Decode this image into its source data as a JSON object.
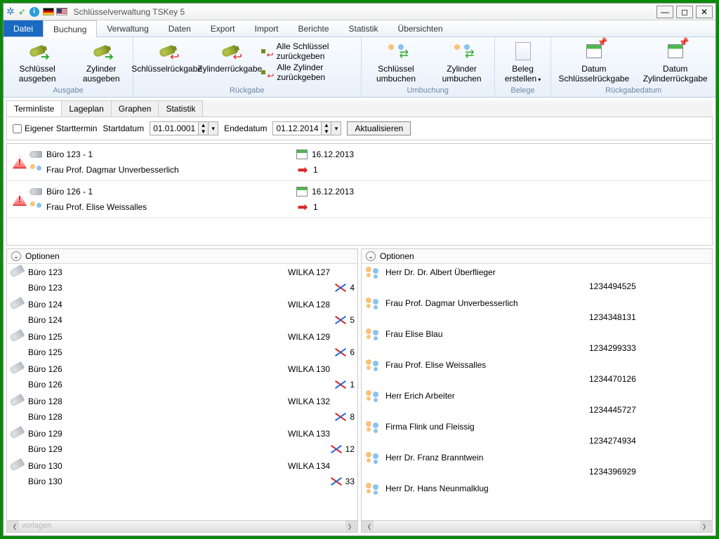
{
  "title": "Schlüsselverwaltung TSKey 5",
  "menu": {
    "datei": "Datei",
    "buchung": "Buchung",
    "verwaltung": "Verwaltung",
    "daten": "Daten",
    "export": "Export",
    "import": "Import",
    "berichte": "Berichte",
    "statistik": "Statistik",
    "uebersichten": "Übersichten"
  },
  "ribbon": {
    "ausgabe": {
      "label": "Ausgabe",
      "schluessel": "Schlüssel ausgeben",
      "zylinder": "Zylinder ausgeben"
    },
    "rueckgabe": {
      "label": "Rückgabe",
      "schl_rg": "Schlüsselrückgabe",
      "zyl_rg": "Zylinderrückgabe",
      "alle_schl": "Alle Schlüssel zurückgeben",
      "alle_zyl": "Alle Zylinder zurückgeben"
    },
    "umbuchung": {
      "label": "Umbuchung",
      "schl_um": "Schlüssel umbuchen",
      "zyl_um": "Zylinder umbuchen"
    },
    "belege": {
      "label": "Belege",
      "beleg": "Beleg erstellen"
    },
    "rgdatum": {
      "label": "Rückgabedatum",
      "dat_schl": "Datum Schlüsselrückgabe",
      "dat_zyl": "Datum Zylinderrückgabe"
    }
  },
  "tabs": {
    "terminliste": "Terminliste",
    "lageplan": "Lageplan",
    "graphen": "Graphen",
    "statistik": "Statistik"
  },
  "filter": {
    "eigener": "Eigener Starttermin",
    "startdatum": "Startdatum",
    "start_val": "01.01.0001",
    "endedatum": "Endedatum",
    "ende_val": "01.12.2014",
    "aktualisieren": "Aktualisieren"
  },
  "appointments": [
    {
      "room": "Büro 123 - 1",
      "person": "Frau Prof. Dagmar Unverbesserlich",
      "date": "16.12.2013",
      "count": "1"
    },
    {
      "room": "Büro 126 - 1",
      "person": "Frau Prof. Elise Weissalles",
      "date": "16.12.2013",
      "count": "1"
    }
  ],
  "optionen": "Optionen",
  "vorlagen": "vorlagen",
  "keys": [
    {
      "room": "Büro 123",
      "wilka": "WILKA 127",
      "n": "4"
    },
    {
      "room": "Büro 124",
      "wilka": "WILKA 128",
      "n": "5"
    },
    {
      "room": "Büro 125",
      "wilka": "WILKA 129",
      "n": "6"
    },
    {
      "room": "Büro 126",
      "wilka": "WILKA 130",
      "n": "1"
    },
    {
      "room": "Büro 128",
      "wilka": "WILKA 132",
      "n": "8"
    },
    {
      "room": "Büro 129",
      "wilka": "WILKA 133",
      "n": "12"
    },
    {
      "room": "Büro 130",
      "wilka": "WILKA 134",
      "n": "33"
    }
  ],
  "persons": [
    {
      "name": "Herr Dr. Dr. Albert Überflieger",
      "num": "1234494525"
    },
    {
      "name": "Frau Prof. Dagmar Unverbesserlich",
      "num": "1234348131"
    },
    {
      "name": "Frau Elise Blau",
      "num": "1234299333"
    },
    {
      "name": "Frau Prof. Elise Weissalles",
      "num": "1234470126"
    },
    {
      "name": "Herr Erich Arbeiter",
      "num": "1234445727"
    },
    {
      "name": "Firma Flink und Fleissig",
      "num": "1234274934"
    },
    {
      "name": "Herr Dr. Franz Branntwein",
      "num": "1234396929"
    },
    {
      "name": "Herr Dr. Hans Neunmalklug",
      "num": ""
    }
  ]
}
